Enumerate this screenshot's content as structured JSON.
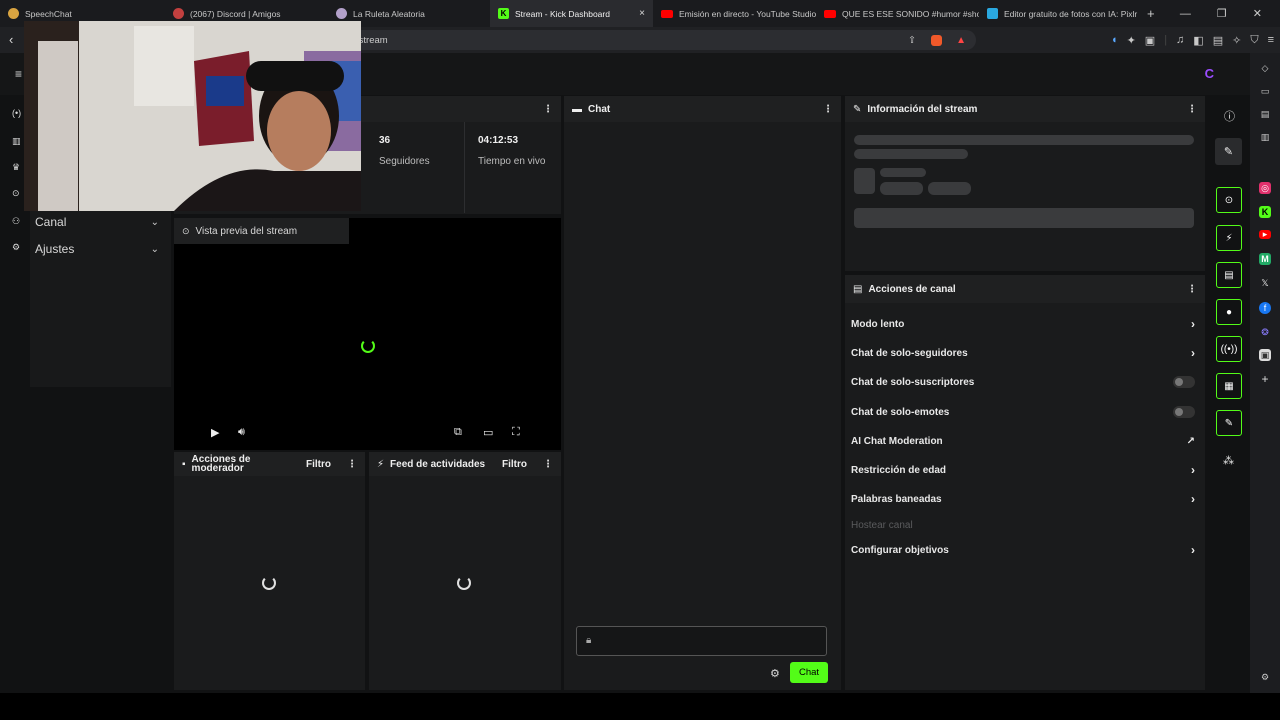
{
  "browser": {
    "tabs": [
      {
        "title": "SpeechChat",
        "color": "#d9a441"
      },
      {
        "title": "(2067) Discord | Amigos",
        "color": "#c2403f"
      },
      {
        "title": "La Ruleta Aleatoria",
        "color": "#b2a0c9"
      },
      {
        "title": "Stream - Kick Dashboard",
        "color": "#53fc18"
      },
      {
        "title": "Emisión en directo - YouTube Studio",
        "color": "#ff0000"
      },
      {
        "title": "QUE ES ESE SONIDO #humor #short",
        "color": "#ff0000"
      },
      {
        "title": "Editor gratuito de fotos con IA: Pixlr",
        "color": "#2aa8e0"
      }
    ],
    "active_tab": 3,
    "close_glyph": "×",
    "new_tab_glyph": "+",
    "address": "/stream"
  },
  "leftnav": {
    "items": [
      {
        "label": "Canal",
        "icon": "people-icon"
      },
      {
        "label": "Ajustes",
        "icon": "gear-icon"
      }
    ]
  },
  "stats": [
    {
      "value": "36",
      "label": "Seguidores"
    },
    {
      "value": "04:12:53",
      "label": "Tiempo en vivo"
    }
  ],
  "preview": {
    "title": "Vista previa del stream"
  },
  "moderator": {
    "title": "Acciones de moderador",
    "filter": "Filtro"
  },
  "activity": {
    "title": "Feed de actividades",
    "filter": "Filtro"
  },
  "chat": {
    "title": "Chat",
    "send_label": "Chat"
  },
  "stream_info": {
    "title": "Información del stream"
  },
  "channel_actions": {
    "title": "Acciones de canal",
    "items": [
      {
        "label": "Modo lento",
        "kind": "arrow"
      },
      {
        "label": "Chat de solo-seguidores",
        "kind": "arrow"
      },
      {
        "label": "Chat de solo-suscriptores",
        "kind": "toggle"
      },
      {
        "label": "Chat de solo-emotes",
        "kind": "toggle"
      },
      {
        "label": "AI Chat Moderation",
        "kind": "external"
      },
      {
        "label": "Restricción de edad",
        "kind": "arrow"
      },
      {
        "label": "Palabras baneadas",
        "kind": "arrow"
      },
      {
        "label": "Hostear canal",
        "kind": "disabled"
      },
      {
        "label": "Configurar objetivos",
        "kind": "arrow"
      }
    ]
  },
  "colors": {
    "accent": "#53fc18",
    "brand": "#9b4dff"
  },
  "brand_mark": "C"
}
